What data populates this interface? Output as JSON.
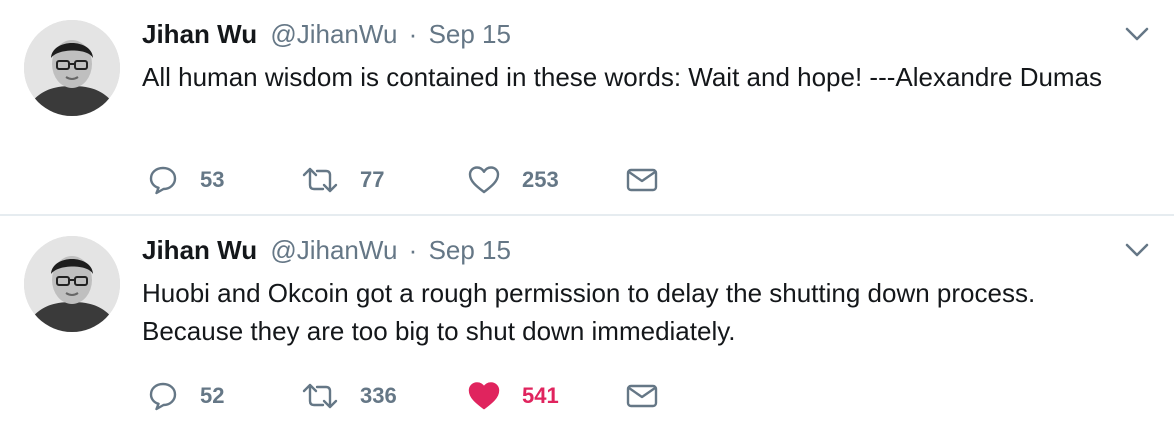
{
  "tweets": [
    {
      "author_name": "Jihan Wu",
      "handle": "@JihanWu",
      "separator": "·",
      "time": "Sep 15",
      "text": "All human wisdom is contained in these words: Wait and hope! ---Alexandre Dumas",
      "reply_count": "53",
      "retweet_count": "77",
      "like_count": "253",
      "liked": false
    },
    {
      "author_name": "Jihan Wu",
      "handle": "@JihanWu",
      "separator": "·",
      "time": "Sep 15",
      "text": "Huobi and Okcoin got a rough permission to delay the shutting down process. Because they are too big to shut down immediately.",
      "reply_count": "52",
      "retweet_count": "336",
      "like_count": "541",
      "liked": true
    }
  ],
  "colors": {
    "muted": "#657786",
    "like_active": "#e0245e",
    "divider": "#e6ecf0"
  },
  "icons": [
    "reply-icon",
    "retweet-icon",
    "heart-icon",
    "envelope-icon",
    "chevron-down-icon"
  ]
}
